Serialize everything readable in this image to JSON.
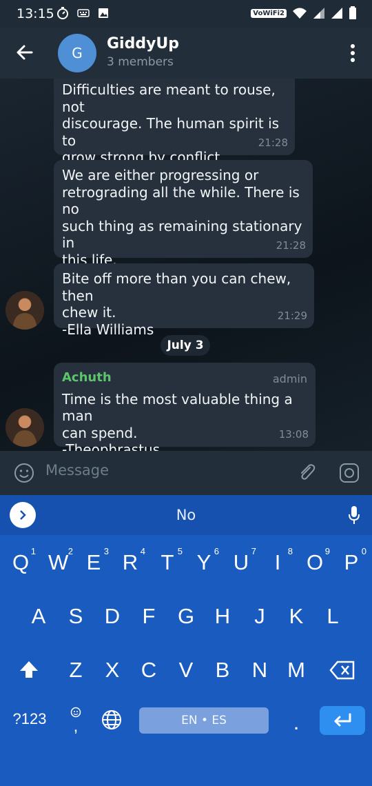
{
  "status": {
    "time": "13:15",
    "wifi_badge": "VoWiFi2"
  },
  "header": {
    "avatar_letter": "G",
    "title": "GiddyUp",
    "subtitle": "3 members"
  },
  "messages": [
    {
      "text": "Difficulties are meant to rouse, not\ndiscourage. The human spirit is to\ngrow strong by conflict.\n-William Channing",
      "time": "21:28"
    },
    {
      "text": "We are either progressing or\nretrograding all the while. There is no\nsuch thing as remaining stationary in\nthis life.\n-James Freeman Clarke",
      "time": "21:28"
    },
    {
      "text": "Bite off more than you can chew, then\nchew it.\n-Ella Williams",
      "time": "21:29"
    },
    {
      "sender": "Achuth",
      "role": "admin",
      "text": "Time is the most valuable thing a man\ncan spend.\n-Theophrastus",
      "time": "13:08"
    }
  ],
  "date_separator": "July 3",
  "composer": {
    "placeholder": "Message"
  },
  "keyboard": {
    "suggestion": "No",
    "row1": [
      "Q",
      "W",
      "E",
      "R",
      "T",
      "Y",
      "U",
      "I",
      "O",
      "P"
    ],
    "row1_nums": [
      "1",
      "2",
      "3",
      "4",
      "5",
      "6",
      "7",
      "8",
      "9",
      "0"
    ],
    "row2": [
      "A",
      "S",
      "D",
      "F",
      "G",
      "H",
      "J",
      "K",
      "L"
    ],
    "row3": [
      "Z",
      "X",
      "C",
      "V",
      "B",
      "N",
      "M"
    ],
    "symbols_label": "?123",
    "comma": ",",
    "space_label": "EN • ES",
    "period": "."
  },
  "colors": {
    "accent": "#4f8fd6",
    "sender": "#5cc46b",
    "keyboard": "#1a5bbf",
    "bubble": "#26313d"
  }
}
